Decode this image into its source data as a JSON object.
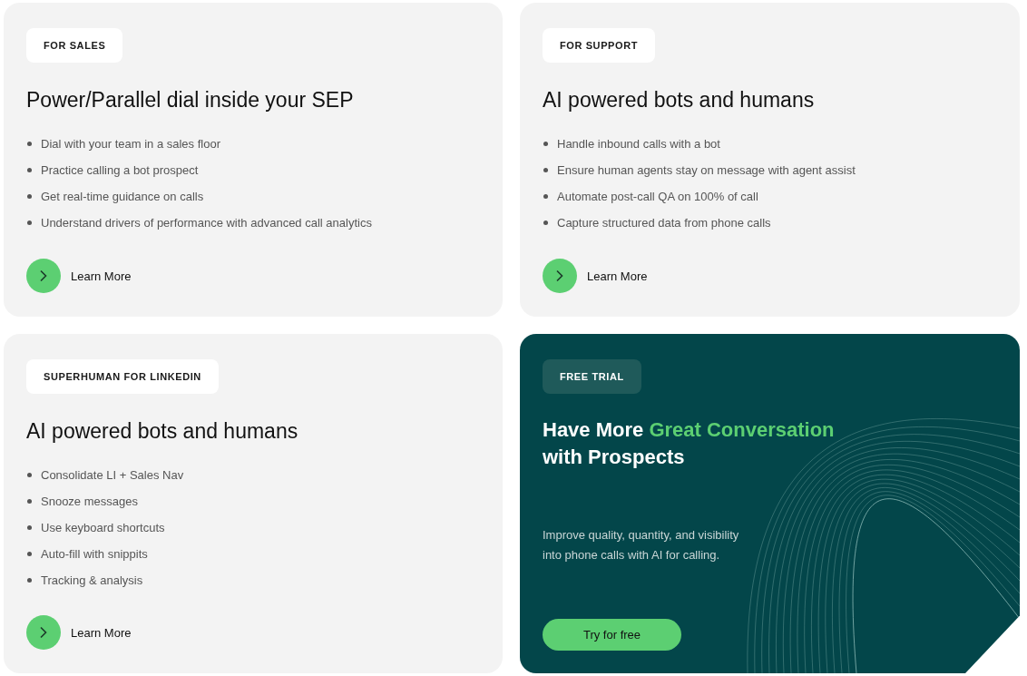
{
  "cards": [
    {
      "kind": "feature",
      "tag": "FOR SALES",
      "title": "Power/Parallel dial inside your SEP",
      "items": [
        "Dial with your team in a sales floor",
        "Practice calling a bot prospect",
        "Get real-time guidance on calls",
        "Understand drivers of performance with advanced call analytics"
      ],
      "link": "Learn More"
    },
    {
      "kind": "feature",
      "tag": "FOR SUPPORT",
      "title": "AI powered bots and humans",
      "items": [
        "Handle inbound calls with a bot",
        "Ensure human agents stay on message with agent assist",
        "Automate post-call QA on 100% of call",
        "Capture structured data from phone calls"
      ],
      "link": "Learn More"
    },
    {
      "kind": "feature",
      "tag": "SUPERHUMAN FOR LINKEDIN",
      "title": "AI powered bots and humans",
      "items": [
        "Consolidate LI + Sales Nav",
        "Snooze messages",
        "Use keyboard shortcuts",
        "Auto-fill with snippits",
        "Tracking & analysis"
      ],
      "link": "Learn More"
    },
    {
      "kind": "promo",
      "tag": "FREE TRIAL",
      "title": [
        {
          "text": "Have More ",
          "accent": false
        },
        {
          "text": "Great Conversation",
          "accent": true
        },
        {
          "text": " with Prospects",
          "accent": false
        }
      ],
      "text": "Improve quality, quantity, and visibility into phone calls with AI for calling.",
      "button": "Try for free"
    }
  ]
}
